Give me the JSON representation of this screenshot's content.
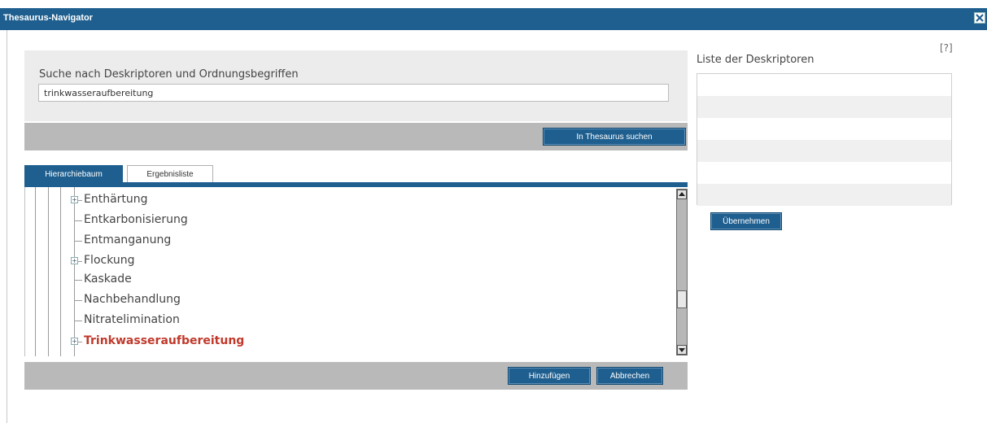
{
  "window": {
    "title": "Thesaurus-Navigator",
    "close_icon": "close-icon",
    "help_label": "[?]"
  },
  "search": {
    "label": "Suche nach Deskriptoren und Ordnungsbegriffen",
    "value": "trinkwasseraufbereitung",
    "button_label": "In Thesaurus suchen"
  },
  "tabs": [
    {
      "label": "Hierarchiebaum",
      "active": true
    },
    {
      "label": "Ergebnisliste",
      "active": false
    }
  ],
  "tree": {
    "items": [
      {
        "label": "Enthärtung",
        "expandable": true,
        "highlight": false
      },
      {
        "label": "Entkarbonisierung",
        "expandable": false,
        "highlight": false
      },
      {
        "label": "Entmanganung",
        "expandable": false,
        "highlight": false
      },
      {
        "label": "Flockung",
        "expandable": true,
        "highlight": false
      },
      {
        "label": "Kaskade",
        "expandable": false,
        "highlight": false
      },
      {
        "label": "Nachbehandlung",
        "expandable": false,
        "highlight": false
      },
      {
        "label": "Nitratelimination",
        "expandable": false,
        "highlight": false
      },
      {
        "label": "Trinkwasseraufbereitung",
        "expandable": true,
        "highlight": true
      }
    ]
  },
  "actions": {
    "add_label": "Hinzufügen",
    "cancel_label": "Abbrechen"
  },
  "descriptors": {
    "title": "Liste der Deskriptoren",
    "rows": [
      "",
      "",
      "",
      "",
      "",
      ""
    ],
    "apply_label": "Übernehmen"
  },
  "colors": {
    "accent": "#1f5f8f",
    "highlight": "#c0392b",
    "panel": "#ececec",
    "bar": "#b9b9b9"
  }
}
